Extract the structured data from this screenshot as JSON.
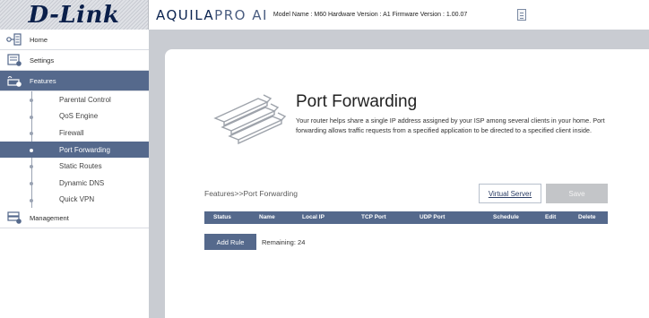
{
  "header": {
    "logo": "D-Link",
    "brand_main": "AQUILA",
    "brand_pro": "PRO AI",
    "model_info": "Model Name : M60 Hardware Version : A1 Firmware Version : 1.00.07"
  },
  "sidebar": {
    "home": "Home",
    "settings": "Settings",
    "features": "Features",
    "management": "Management",
    "features_items": [
      {
        "label": "Parental Control"
      },
      {
        "label": "QoS Engine"
      },
      {
        "label": "Firewall"
      },
      {
        "label": "Port Forwarding"
      },
      {
        "label": "Static Routes"
      },
      {
        "label": "Dynamic DNS"
      },
      {
        "label": "Quick VPN"
      }
    ]
  },
  "main": {
    "title": "Port Forwarding",
    "description": "Your router helps share a single IP address assigned by your ISP among several clients in your home. Port forwarding allows traffic requests from a specified application to be directed to a specified client inside.",
    "breadcrumb": "Features>>Port Forwarding",
    "virtual_server_label": "Virtual Server",
    "save_label": "Save",
    "columns": {
      "status": "Status",
      "name": "Name",
      "local_ip": "Local IP",
      "tcp_port": "TCP Port",
      "udp_port": "UDP Port",
      "schedule": "Schedule",
      "edit": "Edit",
      "delete": "Delete"
    },
    "add_rule_label": "Add Rule",
    "remaining": "Remaining: 24"
  },
  "colors": {
    "accent": "#55698c",
    "logo": "#0a1f4a",
    "save_disabled": "#c3c5c8"
  },
  "icons": [
    "home-icon",
    "settings-icon",
    "features-icon",
    "management-icon",
    "document-icon"
  ]
}
